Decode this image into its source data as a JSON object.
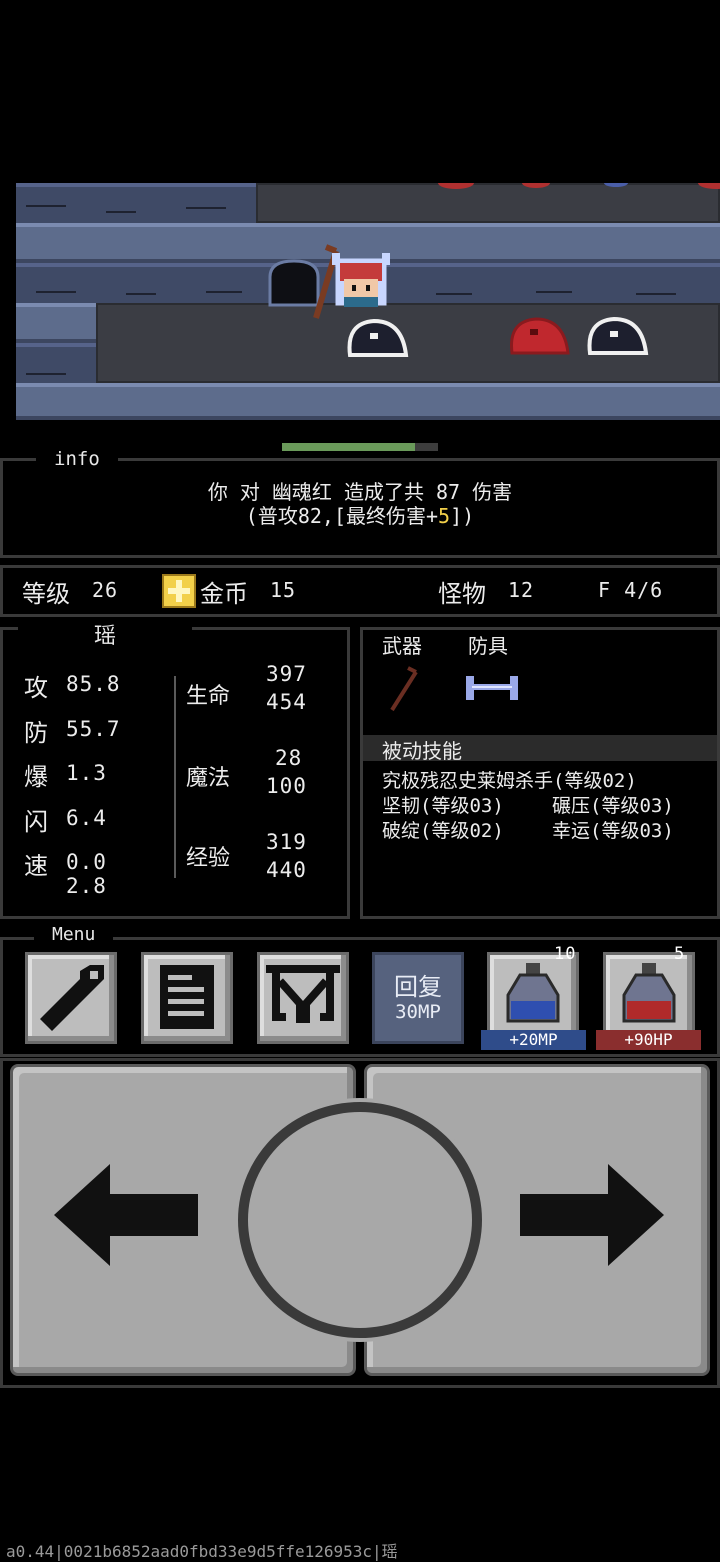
{
  "info": {
    "title": "info",
    "line1": "你 对 幽魂红 造成了共 87 伤害",
    "line2_prefix": "(普攻82,[最终伤害+",
    "line2_bonus": "5",
    "line2_suffix": "])"
  },
  "status": {
    "level_label": "等级",
    "level_value": "26",
    "gold_label": "金币",
    "gold_value": "15",
    "monster_label": "怪物",
    "monster_value": "12",
    "floor": "F 4/6"
  },
  "stats": {
    "name": "瑶",
    "attack_label": "攻",
    "attack_value": "85.8",
    "defense_label": "防",
    "defense_value": "55.7",
    "crit_label": "爆",
    "crit_value": "1.3",
    "dodge_label": "闪",
    "dodge_value": "6.4",
    "speed_label": "速",
    "speed_value_top": "0.0",
    "speed_value_bottom": "2.8",
    "hp_label": "生命",
    "hp_current": "397",
    "hp_max": "454",
    "mp_label": "魔法",
    "mp_current": "28",
    "mp_max": "100",
    "exp_label": "经验",
    "exp_current": "319",
    "exp_max": "440"
  },
  "equipment": {
    "weapon_label": "武器",
    "armor_label": "防具",
    "passive_label": "被动技能",
    "skill1": "究极残忍史莱姆杀手(等级02)",
    "skill2": "坚韧(等级03)",
    "skill3": "碾压(等级03)",
    "skill4": "破绽(等级02)",
    "skill5": "幸运(等级03)"
  },
  "menu": {
    "title": "Menu",
    "recover_label": "回复",
    "recover_cost": "30MP",
    "mp_potion_count": "10",
    "mp_potion_label": "+20MP",
    "hp_potion_count": "5",
    "hp_potion_label": "+90HP"
  },
  "progress": {
    "player_hp_fraction": 0.85
  },
  "footer": "a0.44|0021b6852aad0fbd33e9d5ffe126953c|瑶",
  "colors": {
    "gold": "#f2d04a",
    "mp": "#2f4c8a",
    "hp": "#8a2e2e",
    "bonus": "#f2d04a"
  }
}
